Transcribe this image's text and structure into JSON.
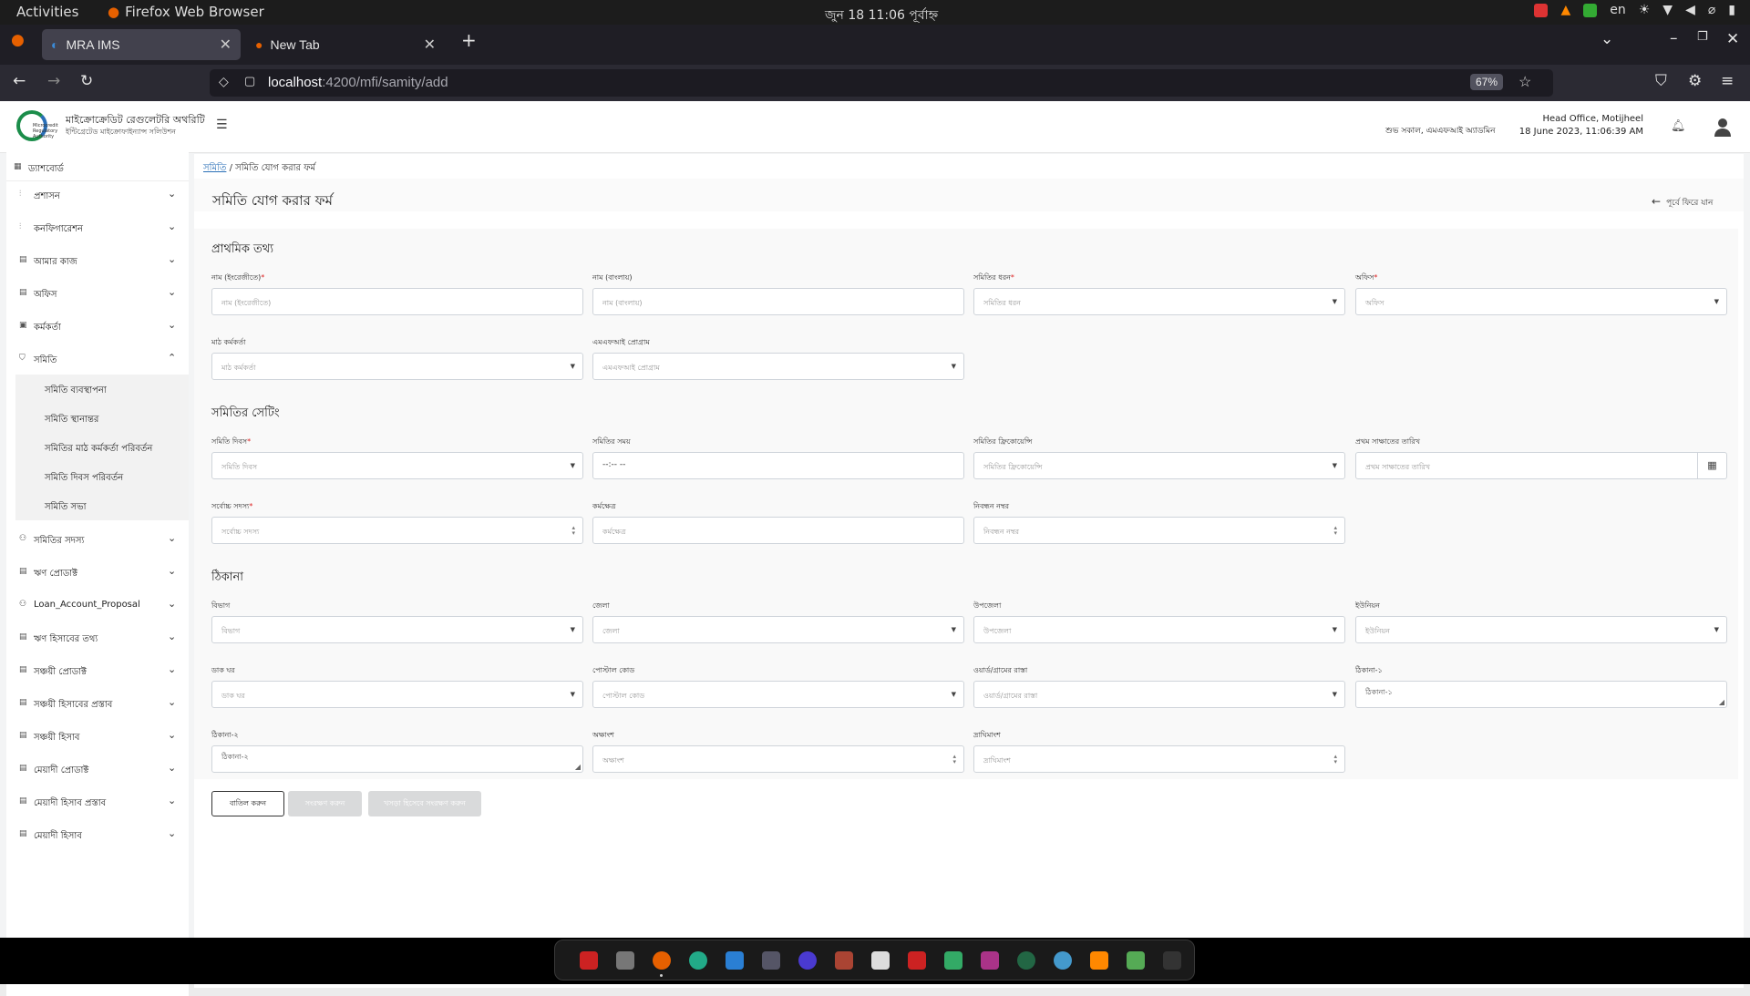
{
  "system": {
    "activities": "Activities",
    "app_name": "Firefox Web Browser",
    "clock": "জুন 18  11:06 পূর্বাহ্ন",
    "lang": "en"
  },
  "browser": {
    "tabs": [
      {
        "label": "MRA IMS"
      },
      {
        "label": "New Tab"
      }
    ],
    "url_host": "localhost",
    "url_path": ":4200/mfi/samity/add",
    "zoom": "67%"
  },
  "header": {
    "logo_text": "Microcredit Regulatory Authority",
    "org_name": "মাইক্রোক্রেডিট রেগুলেটরি অথরিটি",
    "org_sub": "ইন্টিগ্রেটেড মাইক্রোফাইন্যান্স সলিউশন",
    "greeting": "শুভ সকাল, এমএফআই অ্যাডমিন",
    "office": "Head Office, Motijheel",
    "datetime": "18 June 2023, 11:06:39 AM"
  },
  "sidebar": {
    "dashboard": "ড্যাশবোর্ড",
    "items": [
      {
        "label": "প্রশাসন"
      },
      {
        "label": "কনফিগারেশন"
      },
      {
        "label": "আমার কাজ"
      },
      {
        "label": "অফিস"
      },
      {
        "label": "কর্মকর্তা"
      },
      {
        "label": "সমিতি"
      }
    ],
    "sub_items": [
      {
        "label": "সমিতি ব্যবস্থাপনা"
      },
      {
        "label": "সমিতি স্থানান্তর"
      },
      {
        "label": "সমিতির মাঠ কর্মকর্তা পরিবর্তন"
      },
      {
        "label": "সমিতি দিবস পরিবর্তন"
      },
      {
        "label": "সমিতি সভা"
      }
    ],
    "items2": [
      {
        "label": "সমিতির সদস্য"
      },
      {
        "label": "ঋণ প্রোডাক্ট"
      },
      {
        "label": "Loan_Account_Proposal"
      },
      {
        "label": "ঋণ হিসাবের তথ্য"
      },
      {
        "label": "সঞ্চয়ী প্রোডাক্ট"
      },
      {
        "label": "সঞ্চয়ী হিসাবের প্রস্তাব"
      },
      {
        "label": "সঞ্চয়ী হিসাব"
      },
      {
        "label": "মেয়াদী প্রোডাক্ট"
      },
      {
        "label": "মেয়াদী হিসাব প্রস্তাব"
      },
      {
        "label": "মেয়াদী হিসাব"
      }
    ]
  },
  "breadcrumb": {
    "root": "সমিতি",
    "current": " / সমিতি যোগ করার ফর্ম"
  },
  "page_title": "সমিতি যোগ করার ফর্ম",
  "back_label": "পূর্বে ফিরে যান",
  "sections": {
    "basic": "প্রাথমিক তথ্য",
    "settings": "সমিতির সেটিং",
    "address": "ঠিকানা"
  },
  "fields": {
    "name_en": {
      "label": "নাম (ইংরেজীতে)",
      "placeholder": "নাম (ইংরেজীতে)"
    },
    "name_bn": {
      "label": "নাম (বাংলায়)",
      "placeholder": "নাম (বাংলায়)"
    },
    "samity_type": {
      "label": "সমিতির ধরন",
      "placeholder": "সমিতির ধরন"
    },
    "office": {
      "label": "অফিস",
      "placeholder": "অফিস"
    },
    "field_officer": {
      "label": "মাঠ কর্মকর্তা",
      "placeholder": "মাঠ কর্মকর্তা"
    },
    "mfi_program": {
      "label": "এমএফআই প্রোগ্রাম",
      "placeholder": "এমএফআই প্রোগ্রাম"
    },
    "samity_day": {
      "label": "সমিতি দিবস",
      "placeholder": "সমিতি দিবস"
    },
    "samity_time": {
      "label": "সমিতির সময়",
      "value": "--:-- --"
    },
    "frequency": {
      "label": "সমিতির ফ্রিকোয়েন্সি",
      "placeholder": "সমিতির ফ্রিকোয়েন্সি"
    },
    "first_meeting": {
      "label": "প্রথম সাক্ষাতের তারিখ",
      "placeholder": "প্রথম সাক্ষাতের তারিখ"
    },
    "max_members": {
      "label": "সর্বোচ্চ সদস্য",
      "placeholder": "সর্বোচ্চ সদস্য"
    },
    "work_area": {
      "label": "কর্মক্ষেত্র",
      "placeholder": "কর্মক্ষেত্র"
    },
    "reg_no": {
      "label": "নিবন্ধন নম্বর",
      "placeholder": "নিবন্ধন নম্বর"
    },
    "division": {
      "label": "বিভাগ",
      "placeholder": "বিভাগ"
    },
    "district": {
      "label": "জেলা",
      "placeholder": "জেলা"
    },
    "upazila": {
      "label": "উপজেলা",
      "placeholder": "উপজেলা"
    },
    "union": {
      "label": "ইউনিয়ন",
      "placeholder": "ইউনিয়ন"
    },
    "post_office": {
      "label": "ডাক ঘর",
      "placeholder": "ডাক ঘর"
    },
    "postal_code": {
      "label": "পোস্টাল কোড",
      "placeholder": "পোস্টাল কোড"
    },
    "ward": {
      "label": "ওয়ার্ড/গ্রামের রাস্তা",
      "placeholder": "ওয়ার্ড/গ্রামের রাস্তা"
    },
    "address1": {
      "label": "ঠিকানা-১",
      "placeholder": "ঠিকানা-১"
    },
    "address2": {
      "label": "ঠিকানা-২",
      "placeholder": "ঠিকানা-২"
    },
    "latitude": {
      "label": "অক্ষাংশ",
      "placeholder": "অক্ষাংশ"
    },
    "longitude": {
      "label": "দ্রাঘিমাংশ",
      "placeholder": "দ্রাঘিমাংশ"
    }
  },
  "buttons": {
    "cancel": "বাতিল করুন",
    "save": "সংরক্ষণ করুন",
    "save_draft": "খসড়া হিসেবে সংরক্ষণ করুন"
  }
}
